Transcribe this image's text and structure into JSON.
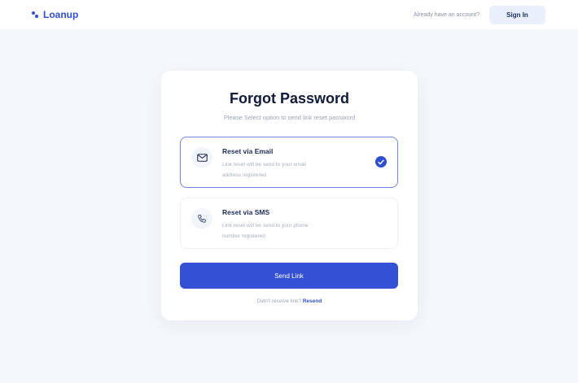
{
  "header": {
    "brand": "Loanup",
    "account_prompt": "Already have an account?",
    "signin_label": "Sign In"
  },
  "card": {
    "title": "Forgot Password",
    "subtitle": "Please Select option to send link reset password",
    "options": [
      {
        "title": "Reset via Email",
        "description": "Link reset will be send to your email address registered",
        "icon": "mail-icon",
        "selected": true
      },
      {
        "title": "Reset via SMS",
        "description": "Link reset will be send to your phone number registered",
        "icon": "phone-icon",
        "selected": false
      }
    ],
    "send_label": "Send Link",
    "resend_prompt": "Didn't receive link?",
    "resend_label": "Resend"
  },
  "colors": {
    "accent": "#3450d4",
    "background": "#f4f7fb",
    "heading": "#111a3a"
  }
}
